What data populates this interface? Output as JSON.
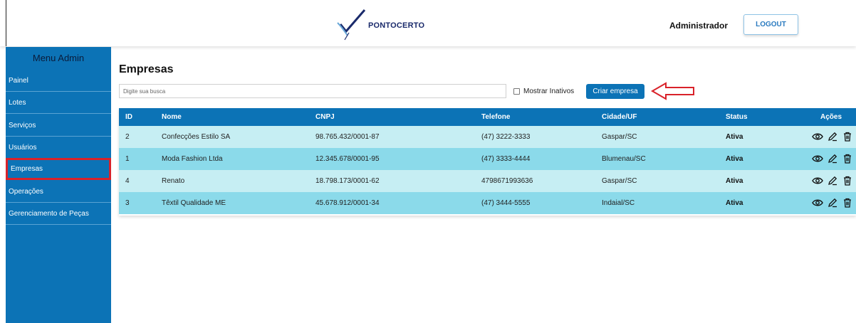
{
  "header": {
    "brand": "PONTOCERTO",
    "user": "Administrador",
    "logout_label": "LOGOUT"
  },
  "sidebar": {
    "title": "Menu Admin",
    "items": [
      {
        "label": "Painel"
      },
      {
        "label": "Lotes"
      },
      {
        "label": "Serviços"
      },
      {
        "label": "Usuários"
      },
      {
        "label": "Empresas",
        "active": true
      },
      {
        "label": "Operações"
      },
      {
        "label": "Gerenciamento de Peças"
      }
    ]
  },
  "main": {
    "title": "Empresas",
    "search_placeholder": "Digite sua busca",
    "show_inactive_label": "Mostrar Inativos",
    "create_label": "Criar empresa"
  },
  "table": {
    "headers": [
      "ID",
      "Nome",
      "CNPJ",
      "Telefone",
      "Cidade/UF",
      "Status",
      "Ações"
    ],
    "rows": [
      {
        "id": "2",
        "nome": "Confecções Estilo SA",
        "cnpj": "98.765.432/0001-87",
        "telefone": "(47) 3222-3333",
        "cidade": "Gaspar/SC",
        "status": "Ativa"
      },
      {
        "id": "1",
        "nome": "Moda Fashion Ltda",
        "cnpj": "12.345.678/0001-95",
        "telefone": "(47) 3333-4444",
        "cidade": "Blumenau/SC",
        "status": "Ativa"
      },
      {
        "id": "4",
        "nome": "Renato",
        "cnpj": "18.798.173/0001-62",
        "telefone": "4798671993636",
        "cidade": "Gaspar/SC",
        "status": "Ativa"
      },
      {
        "id": "3",
        "nome": "Têxtil Qualidade ME",
        "cnpj": "45.678.912/0001-34",
        "telefone": "(47) 3444-5555",
        "cidade": "Indaial/SC",
        "status": "Ativa"
      }
    ]
  },
  "colors": {
    "primary": "#0c73b6",
    "row_light": "#c6eef3",
    "row_dark": "#8bdaea",
    "highlight": "#d9222a"
  },
  "icons": [
    "logo-check-icon",
    "eye-icon",
    "pencil-icon",
    "trash-icon",
    "red-arrow-icon"
  ]
}
